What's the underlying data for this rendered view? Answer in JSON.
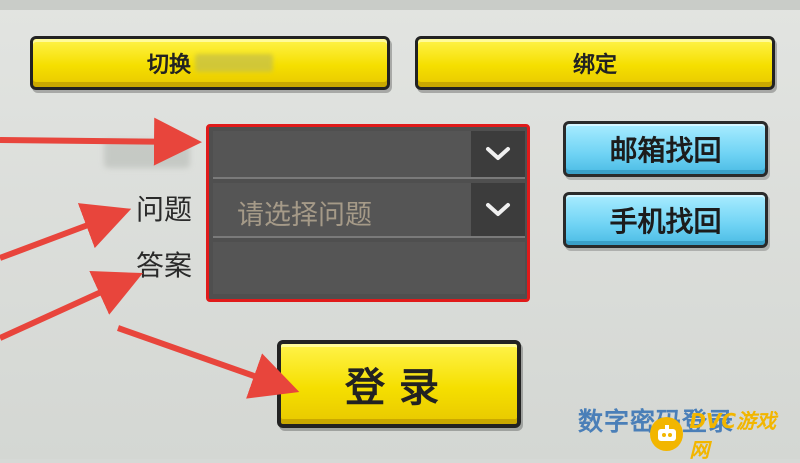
{
  "top_buttons": {
    "switch_label": "切换",
    "bind_label": "绑定"
  },
  "form": {
    "account_label": "",
    "question_label": "问题",
    "answer_label": "答案",
    "question_placeholder": "请选择问题"
  },
  "recovery": {
    "email_label": "邮箱找回",
    "phone_label": "手机找回"
  },
  "login": {
    "label": "登录"
  },
  "footer": {
    "link_text": "数字密码登录",
    "watermark_text": "DVC游戏网"
  },
  "icons": {
    "dropdown": "chevron-down-icon",
    "arrow": "red-annotation-arrow"
  },
  "colors": {
    "highlight_border": "#e01a1a",
    "arrow": "#e8453c",
    "primary_button": "#f5df00",
    "secondary_button": "#6fd3f4"
  }
}
